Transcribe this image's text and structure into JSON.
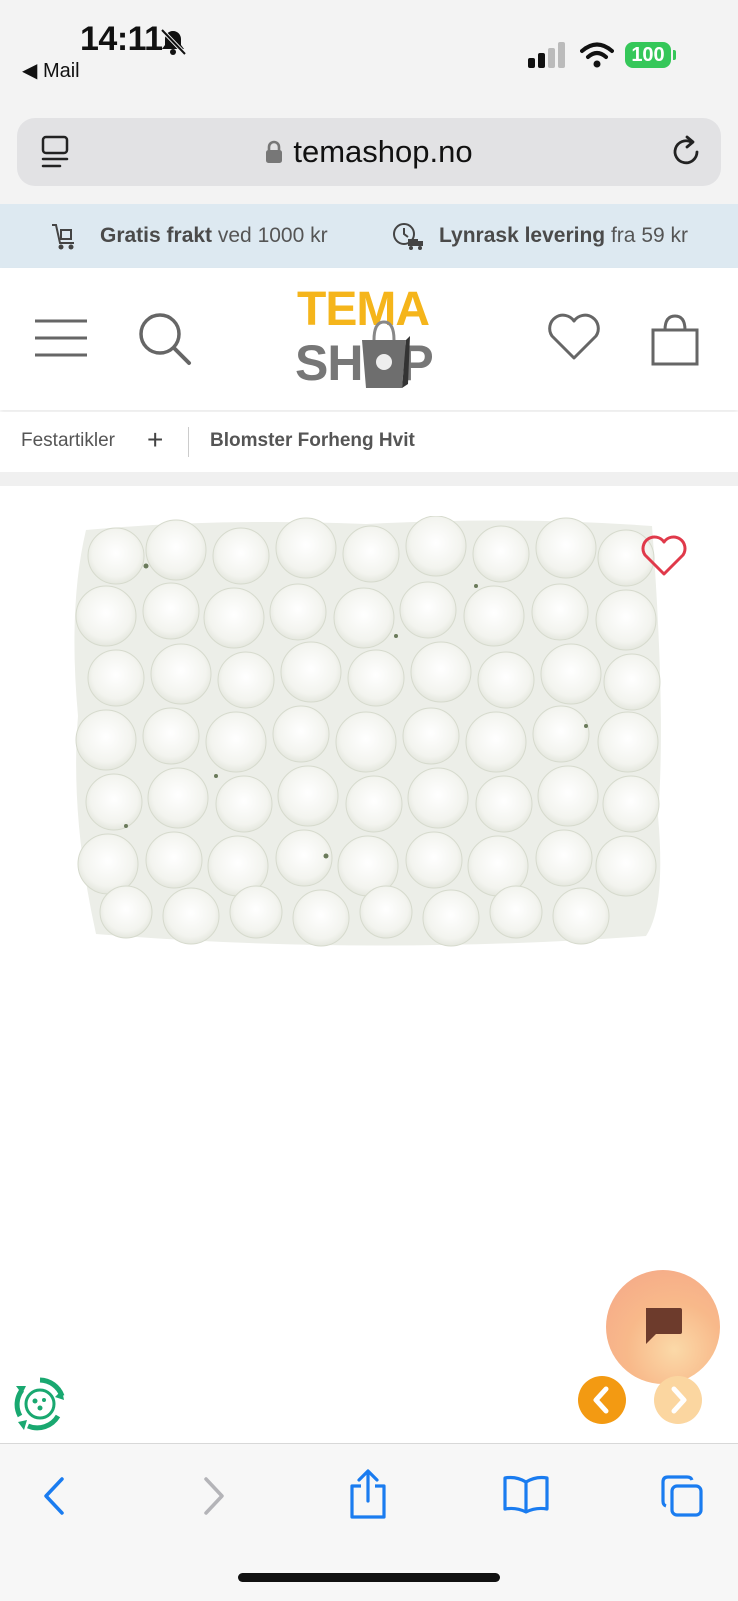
{
  "status_bar": {
    "time": "14:11",
    "back_app": "Mail",
    "battery": "100"
  },
  "browser": {
    "url": "temashop.no"
  },
  "promo": {
    "item1_bold": "Gratis frakt",
    "item1_rest": " ved 1000 kr",
    "item2_bold": "Lynrask levering",
    "item2_rest": " fra 59 kr"
  },
  "header": {
    "logo_top": "TEMA",
    "logo_bottom": "SHOP"
  },
  "breadcrumb": {
    "category": "Festartikler",
    "expand": "+",
    "current": "Blomster Forheng Hvit"
  },
  "colors": {
    "brand_yellow": "#f5b51b",
    "brand_gray": "#777777",
    "promo_bg": "#dde9f1",
    "arrow_orange": "#f39a12",
    "ios_blue": "#1a7cf0",
    "wishlist_red": "#e0394a"
  },
  "icons": [
    "bell-slash-icon",
    "signal-icon",
    "wifi-icon",
    "tabs-list-icon",
    "lock-icon",
    "reload-icon",
    "cart-trolley-icon",
    "clock-truck-icon",
    "hamburger-menu-icon",
    "search-icon",
    "heart-icon",
    "shopping-bag-icon",
    "wishlist-heart-icon",
    "chat-icon",
    "chevron-left-icon",
    "chevron-right-icon",
    "recycle-icon",
    "back-icon",
    "forward-icon",
    "share-icon",
    "bookmarks-icon",
    "tabs-icon"
  ]
}
